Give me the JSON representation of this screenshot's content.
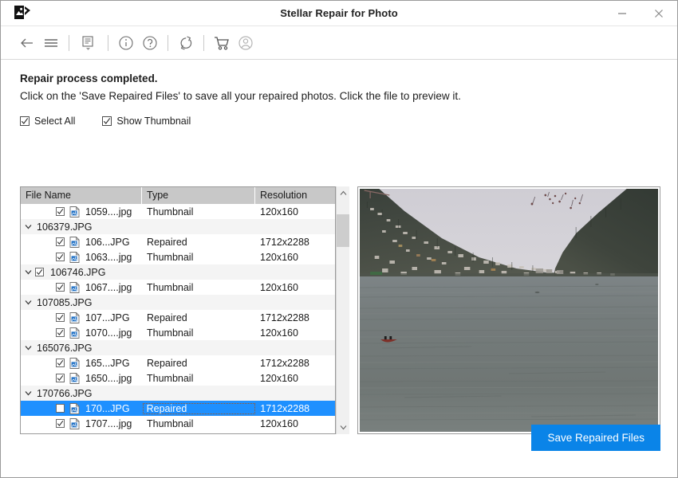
{
  "window": {
    "title": "Stellar Repair for Photo",
    "logo_icon": "photo-repair-logo-icon",
    "minimize_label": "—",
    "close_label": "✕"
  },
  "toolbar": {
    "items": [
      {
        "name": "back-arrow-icon",
        "glyph": "arrow-left"
      },
      {
        "name": "hamburger-menu-icon",
        "glyph": "menu"
      },
      {
        "name": "log-report-icon",
        "glyph": "log-dropdown"
      },
      {
        "name": "info-icon",
        "glyph": "info-circle"
      },
      {
        "name": "help-icon",
        "glyph": "question-circle"
      },
      {
        "name": "refresh-icon",
        "glyph": "refresh-loop"
      },
      {
        "name": "cart-icon",
        "glyph": "shopping-cart"
      },
      {
        "name": "account-icon",
        "glyph": "user-circle"
      }
    ]
  },
  "messages": {
    "title": "Repair process completed.",
    "subtitle": "Click on the 'Save Repaired Files' to save all your repaired photos. Click the file to preview it."
  },
  "options": {
    "select_all_label": "Select All",
    "select_all_checked": true,
    "show_thumbnail_label": "Show Thumbnail",
    "show_thumbnail_checked": true
  },
  "table": {
    "columns": [
      "File Name",
      "Type",
      "Resolution"
    ],
    "rows": [
      {
        "kind": "file",
        "checked": true,
        "name": "1059....jpg",
        "type": "Thumbnail",
        "resolution": "120x160",
        "selected": false
      },
      {
        "kind": "group",
        "checked": false,
        "has_checkbox": false,
        "name": "106379.JPG",
        "type": "",
        "resolution": "",
        "selected": false
      },
      {
        "kind": "file",
        "checked": true,
        "name": "106...JPG",
        "type": "Repaired",
        "resolution": "1712x2288",
        "selected": false
      },
      {
        "kind": "file",
        "checked": true,
        "name": "1063....jpg",
        "type": "Thumbnail",
        "resolution": "120x160",
        "selected": false
      },
      {
        "kind": "group",
        "checked": true,
        "has_checkbox": true,
        "name": "106746.JPG",
        "type": "",
        "resolution": "",
        "selected": false
      },
      {
        "kind": "file",
        "checked": true,
        "name": "1067....jpg",
        "type": "Thumbnail",
        "resolution": "120x160",
        "selected": false
      },
      {
        "kind": "group",
        "checked": false,
        "has_checkbox": false,
        "name": "107085.JPG",
        "type": "",
        "resolution": "",
        "selected": false
      },
      {
        "kind": "file",
        "checked": true,
        "name": "107...JPG",
        "type": "Repaired",
        "resolution": "1712x2288",
        "selected": false
      },
      {
        "kind": "file",
        "checked": true,
        "name": "1070....jpg",
        "type": "Thumbnail",
        "resolution": "120x160",
        "selected": false
      },
      {
        "kind": "group",
        "checked": false,
        "has_checkbox": false,
        "name": "165076.JPG",
        "type": "",
        "resolution": "",
        "selected": false
      },
      {
        "kind": "file",
        "checked": true,
        "name": "165...JPG",
        "type": "Repaired",
        "resolution": "1712x2288",
        "selected": false
      },
      {
        "kind": "file",
        "checked": true,
        "name": "1650....jpg",
        "type": "Thumbnail",
        "resolution": "120x160",
        "selected": false
      },
      {
        "kind": "group",
        "checked": false,
        "has_checkbox": false,
        "name": "170766.JPG",
        "type": "",
        "resolution": "",
        "selected": false
      },
      {
        "kind": "file",
        "checked": true,
        "name": "170...JPG",
        "type": "Repaired",
        "resolution": "1712x2288",
        "selected": true
      },
      {
        "kind": "file",
        "checked": true,
        "name": "1707....jpg",
        "type": "Thumbnail",
        "resolution": "120x160",
        "selected": false
      }
    ]
  },
  "scrollbar": {
    "up_arrow_icon": "chevron-up-icon",
    "down_arrow_icon": "chevron-down-icon"
  },
  "preview": {
    "description": "Lake with forested hills and a small red boat"
  },
  "footer": {
    "save_label": "Save Repaired Files"
  },
  "colors": {
    "accent": "#0a84e8",
    "selection": "#1e90ff",
    "header_gray": "#c8c8c8",
    "group_row": "#f4f4f4",
    "focus_outline": "#a05520"
  }
}
